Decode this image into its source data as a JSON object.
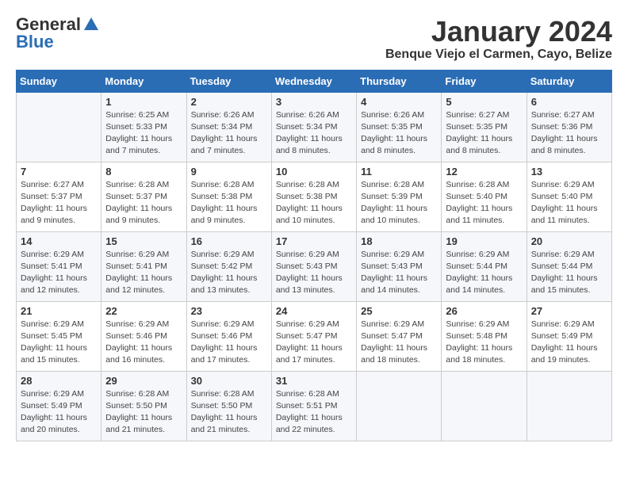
{
  "header": {
    "logo_general": "General",
    "logo_blue": "Blue",
    "month_title": "January 2024",
    "location": "Benque Viejo el Carmen, Cayo, Belize"
  },
  "calendar": {
    "days_of_week": [
      "Sunday",
      "Monday",
      "Tuesday",
      "Wednesday",
      "Thursday",
      "Friday",
      "Saturday"
    ],
    "weeks": [
      [
        {
          "day": "",
          "info": ""
        },
        {
          "day": "1",
          "info": "Sunrise: 6:25 AM\nSunset: 5:33 PM\nDaylight: 11 hours\nand 7 minutes."
        },
        {
          "day": "2",
          "info": "Sunrise: 6:26 AM\nSunset: 5:34 PM\nDaylight: 11 hours\nand 7 minutes."
        },
        {
          "day": "3",
          "info": "Sunrise: 6:26 AM\nSunset: 5:34 PM\nDaylight: 11 hours\nand 8 minutes."
        },
        {
          "day": "4",
          "info": "Sunrise: 6:26 AM\nSunset: 5:35 PM\nDaylight: 11 hours\nand 8 minutes."
        },
        {
          "day": "5",
          "info": "Sunrise: 6:27 AM\nSunset: 5:35 PM\nDaylight: 11 hours\nand 8 minutes."
        },
        {
          "day": "6",
          "info": "Sunrise: 6:27 AM\nSunset: 5:36 PM\nDaylight: 11 hours\nand 8 minutes."
        }
      ],
      [
        {
          "day": "7",
          "info": "Sunrise: 6:27 AM\nSunset: 5:37 PM\nDaylight: 11 hours\nand 9 minutes."
        },
        {
          "day": "8",
          "info": "Sunrise: 6:28 AM\nSunset: 5:37 PM\nDaylight: 11 hours\nand 9 minutes."
        },
        {
          "day": "9",
          "info": "Sunrise: 6:28 AM\nSunset: 5:38 PM\nDaylight: 11 hours\nand 9 minutes."
        },
        {
          "day": "10",
          "info": "Sunrise: 6:28 AM\nSunset: 5:38 PM\nDaylight: 11 hours\nand 10 minutes."
        },
        {
          "day": "11",
          "info": "Sunrise: 6:28 AM\nSunset: 5:39 PM\nDaylight: 11 hours\nand 10 minutes."
        },
        {
          "day": "12",
          "info": "Sunrise: 6:28 AM\nSunset: 5:40 PM\nDaylight: 11 hours\nand 11 minutes."
        },
        {
          "day": "13",
          "info": "Sunrise: 6:29 AM\nSunset: 5:40 PM\nDaylight: 11 hours\nand 11 minutes."
        }
      ],
      [
        {
          "day": "14",
          "info": "Sunrise: 6:29 AM\nSunset: 5:41 PM\nDaylight: 11 hours\nand 12 minutes."
        },
        {
          "day": "15",
          "info": "Sunrise: 6:29 AM\nSunset: 5:41 PM\nDaylight: 11 hours\nand 12 minutes."
        },
        {
          "day": "16",
          "info": "Sunrise: 6:29 AM\nSunset: 5:42 PM\nDaylight: 11 hours\nand 13 minutes."
        },
        {
          "day": "17",
          "info": "Sunrise: 6:29 AM\nSunset: 5:43 PM\nDaylight: 11 hours\nand 13 minutes."
        },
        {
          "day": "18",
          "info": "Sunrise: 6:29 AM\nSunset: 5:43 PM\nDaylight: 11 hours\nand 14 minutes."
        },
        {
          "day": "19",
          "info": "Sunrise: 6:29 AM\nSunset: 5:44 PM\nDaylight: 11 hours\nand 14 minutes."
        },
        {
          "day": "20",
          "info": "Sunrise: 6:29 AM\nSunset: 5:44 PM\nDaylight: 11 hours\nand 15 minutes."
        }
      ],
      [
        {
          "day": "21",
          "info": "Sunrise: 6:29 AM\nSunset: 5:45 PM\nDaylight: 11 hours\nand 15 minutes."
        },
        {
          "day": "22",
          "info": "Sunrise: 6:29 AM\nSunset: 5:46 PM\nDaylight: 11 hours\nand 16 minutes."
        },
        {
          "day": "23",
          "info": "Sunrise: 6:29 AM\nSunset: 5:46 PM\nDaylight: 11 hours\nand 17 minutes."
        },
        {
          "day": "24",
          "info": "Sunrise: 6:29 AM\nSunset: 5:47 PM\nDaylight: 11 hours\nand 17 minutes."
        },
        {
          "day": "25",
          "info": "Sunrise: 6:29 AM\nSunset: 5:47 PM\nDaylight: 11 hours\nand 18 minutes."
        },
        {
          "day": "26",
          "info": "Sunrise: 6:29 AM\nSunset: 5:48 PM\nDaylight: 11 hours\nand 18 minutes."
        },
        {
          "day": "27",
          "info": "Sunrise: 6:29 AM\nSunset: 5:49 PM\nDaylight: 11 hours\nand 19 minutes."
        }
      ],
      [
        {
          "day": "28",
          "info": "Sunrise: 6:29 AM\nSunset: 5:49 PM\nDaylight: 11 hours\nand 20 minutes."
        },
        {
          "day": "29",
          "info": "Sunrise: 6:28 AM\nSunset: 5:50 PM\nDaylight: 11 hours\nand 21 minutes."
        },
        {
          "day": "30",
          "info": "Sunrise: 6:28 AM\nSunset: 5:50 PM\nDaylight: 11 hours\nand 21 minutes."
        },
        {
          "day": "31",
          "info": "Sunrise: 6:28 AM\nSunset: 5:51 PM\nDaylight: 11 hours\nand 22 minutes."
        },
        {
          "day": "",
          "info": ""
        },
        {
          "day": "",
          "info": ""
        },
        {
          "day": "",
          "info": ""
        }
      ]
    ]
  }
}
